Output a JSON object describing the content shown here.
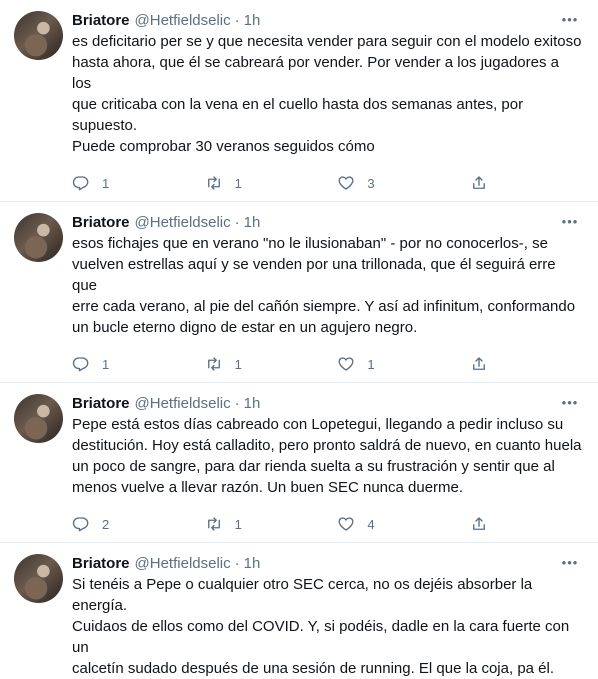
{
  "tweets": [
    {
      "name": "Briatore",
      "handle": "@Hetfieldselic",
      "time": "1h",
      "text": "es deficitario per se y que necesita vender para seguir con el modelo exitoso\nhasta ahora, que él se cabreará por vender. Por vender a los jugadores a los\nque criticaba con la vena en el cuello hasta dos semanas antes, por supuesto.\nPuede comprobar 30 veranos seguidos cómo",
      "replies": "1",
      "retweets": "1",
      "likes": "3"
    },
    {
      "name": "Briatore",
      "handle": "@Hetfieldselic",
      "time": "1h",
      "text": "esos fichajes que en verano \"no le ilusionaban\" - por no conocerlos-, se\nvuelven estrellas aquí y se venden por una trillonada, que él seguirá erre que\nerre cada verano, al pie del cañón siempre. Y así ad infinitum, conformando\nun bucle eterno digno de estar en un agujero negro.",
      "replies": "1",
      "retweets": "1",
      "likes": "1"
    },
    {
      "name": "Briatore",
      "handle": "@Hetfieldselic",
      "time": "1h",
      "text": "Pepe está estos días cabreado con Lopetegui, llegando a pedir incluso su\ndestitución. Hoy está calladito, pero pronto saldrá de nuevo, en cuanto huela\nun poco de sangre, para dar rienda suelta a su frustración y sentir que al\nmenos vuelve a llevar razón. Un buen SEC nunca duerme.",
      "replies": "2",
      "retweets": "1",
      "likes": "4"
    },
    {
      "name": "Briatore",
      "handle": "@Hetfieldselic",
      "time": "1h",
      "text": "Si tenéis a Pepe o cualquier otro SEC cerca, no os dejéis absorber la energía.\nCuidaos de ellos como del COVID. Y, si podéis, dadle en la cara fuerte con un\ncalcetín sudado después de una sesión de running. El que la coja, pa él.",
      "replies": "",
      "retweets": "",
      "likes": ""
    }
  ],
  "icons": {
    "more": "more-icon",
    "reply": "reply-icon",
    "retweet": "retweet-icon",
    "like": "like-icon",
    "share": "share-icon"
  },
  "colors": {
    "text": "#0f1419",
    "secondary": "#5b7083",
    "divider": "#e6ecf0"
  }
}
